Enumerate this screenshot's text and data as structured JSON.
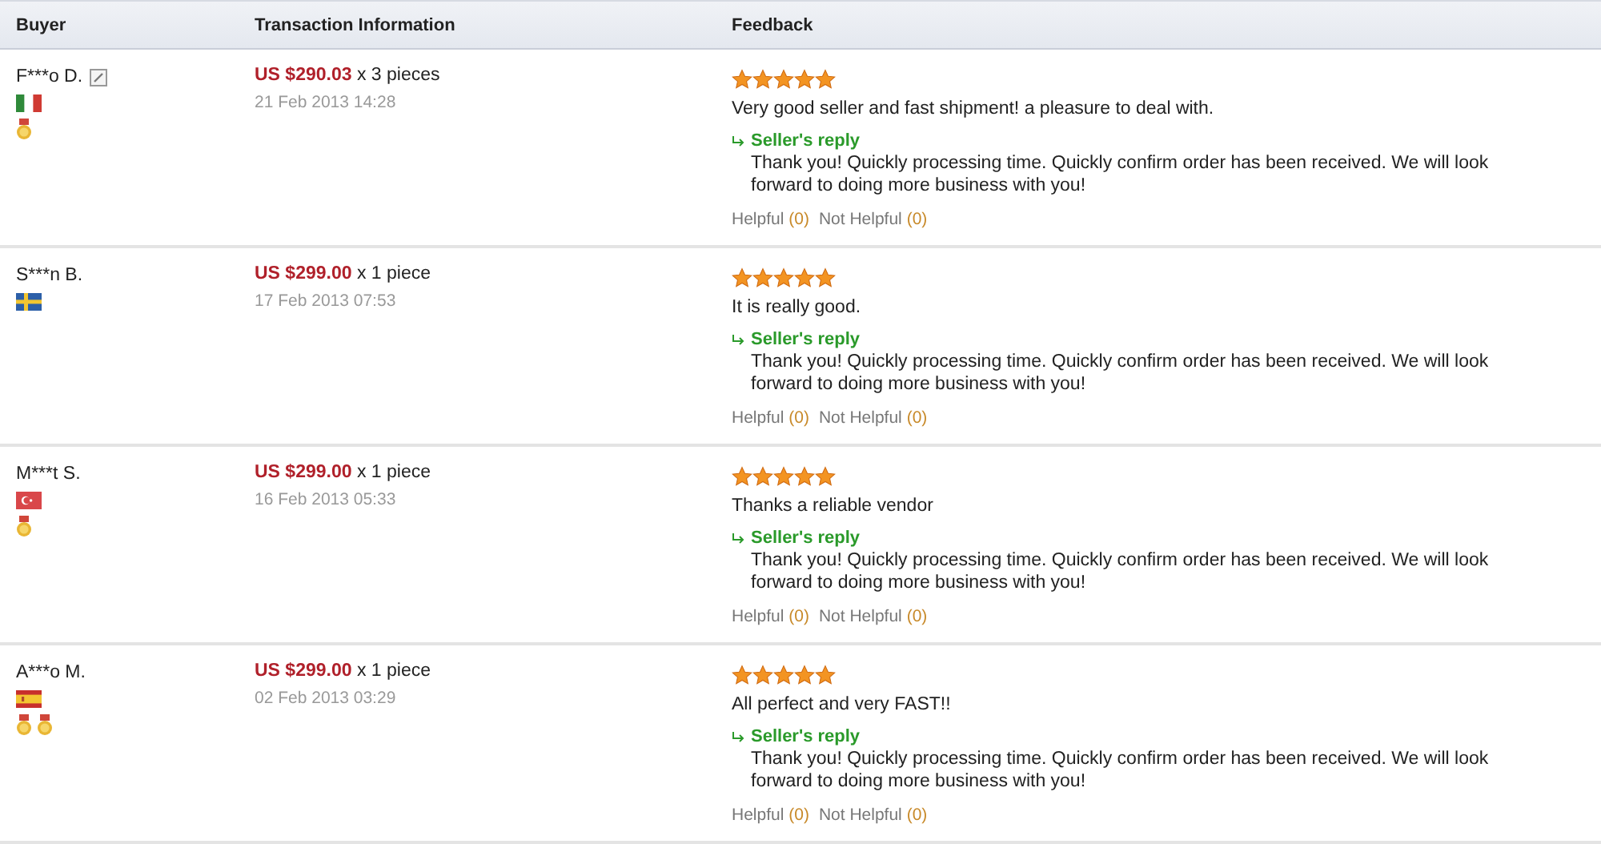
{
  "columns": [
    "Buyer",
    "Transaction Information",
    "Feedback"
  ],
  "rows": [
    {
      "buyer": "F***o D.",
      "edit_icon": true,
      "flag": {
        "kind": "it"
      },
      "badges": [
        {
          "kind": "medal"
        }
      ],
      "price": "US $290.03",
      "quantity": "x 3 pieces",
      "date": "21 Feb 2013 14:28",
      "stars": 5,
      "comment": "Very good seller and fast shipment! a pleasure to deal with.",
      "reply_label": "Seller's reply",
      "reply": "Thank you! Quickly processing time. Quickly confirm order has been received. We will look forward to doing more business with you!",
      "helpful_label": "Helpful",
      "helpful_count": "(0)",
      "not_helpful_label": "Not Helpful",
      "not_helpful_count": "(0)"
    },
    {
      "buyer": "S***n B.",
      "edit_icon": false,
      "flag": {
        "kind": "se"
      },
      "badges": [],
      "price": "US $299.00",
      "quantity": "x 1 piece",
      "date": "17 Feb 2013 07:53",
      "stars": 5,
      "comment": "It is really good.",
      "reply_label": "Seller's reply",
      "reply": "Thank you! Quickly processing time. Quickly confirm order has been received. We will look forward to doing more business with you!",
      "helpful_label": "Helpful",
      "helpful_count": "(0)",
      "not_helpful_label": "Not Helpful",
      "not_helpful_count": "(0)"
    },
    {
      "buyer": "M***t S.",
      "edit_icon": false,
      "flag": {
        "kind": "tr"
      },
      "badges": [
        {
          "kind": "medal"
        }
      ],
      "price": "US $299.00",
      "quantity": "x 1 piece",
      "date": "16 Feb 2013 05:33",
      "stars": 5,
      "comment": "Thanks a reliable vendor",
      "reply_label": "Seller's reply",
      "reply": "Thank you! Quickly processing time. Quickly confirm order has been received. We will look forward to doing more business with you!",
      "helpful_label": "Helpful",
      "helpful_count": "(0)",
      "not_helpful_label": "Not Helpful",
      "not_helpful_count": "(0)"
    },
    {
      "buyer": "A***o M.",
      "edit_icon": false,
      "flag": {
        "kind": "es"
      },
      "badges": [
        {
          "kind": "medal"
        },
        {
          "kind": "medal"
        }
      ],
      "price": "US $299.00",
      "quantity": "x 1 piece",
      "date": "02 Feb 2013 03:29",
      "stars": 5,
      "comment": "All perfect and very FAST!!",
      "reply_label": "Seller's reply",
      "reply": "Thank you! Quickly processing time. Quickly confirm order has been received. We will look forward to doing more business with you!",
      "helpful_label": "Helpful",
      "helpful_count": "(0)",
      "not_helpful_label": "Not Helpful",
      "not_helpful_count": "(0)"
    }
  ]
}
